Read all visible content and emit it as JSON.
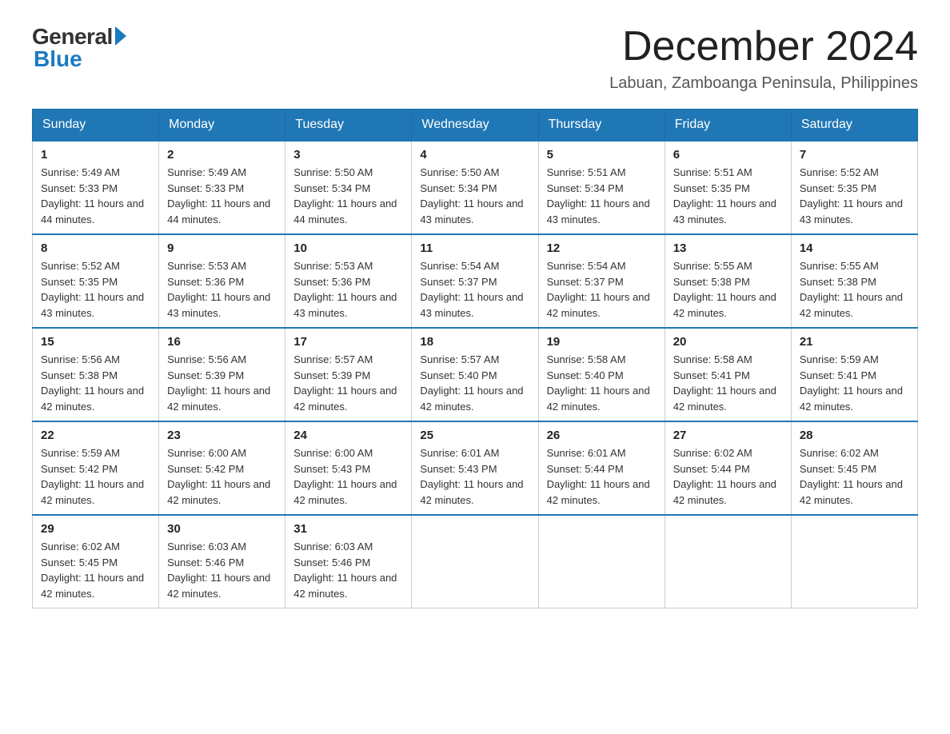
{
  "logo": {
    "general": "General",
    "blue": "Blue"
  },
  "header": {
    "month_title": "December 2024",
    "location": "Labuan, Zamboanga Peninsula, Philippines"
  },
  "weekdays": [
    "Sunday",
    "Monday",
    "Tuesday",
    "Wednesday",
    "Thursday",
    "Friday",
    "Saturday"
  ],
  "weeks": [
    [
      {
        "day": "1",
        "sunrise": "5:49 AM",
        "sunset": "5:33 PM",
        "daylight": "11 hours and 44 minutes."
      },
      {
        "day": "2",
        "sunrise": "5:49 AM",
        "sunset": "5:33 PM",
        "daylight": "11 hours and 44 minutes."
      },
      {
        "day": "3",
        "sunrise": "5:50 AM",
        "sunset": "5:34 PM",
        "daylight": "11 hours and 44 minutes."
      },
      {
        "day": "4",
        "sunrise": "5:50 AM",
        "sunset": "5:34 PM",
        "daylight": "11 hours and 43 minutes."
      },
      {
        "day": "5",
        "sunrise": "5:51 AM",
        "sunset": "5:34 PM",
        "daylight": "11 hours and 43 minutes."
      },
      {
        "day": "6",
        "sunrise": "5:51 AM",
        "sunset": "5:35 PM",
        "daylight": "11 hours and 43 minutes."
      },
      {
        "day": "7",
        "sunrise": "5:52 AM",
        "sunset": "5:35 PM",
        "daylight": "11 hours and 43 minutes."
      }
    ],
    [
      {
        "day": "8",
        "sunrise": "5:52 AM",
        "sunset": "5:35 PM",
        "daylight": "11 hours and 43 minutes."
      },
      {
        "day": "9",
        "sunrise": "5:53 AM",
        "sunset": "5:36 PM",
        "daylight": "11 hours and 43 minutes."
      },
      {
        "day": "10",
        "sunrise": "5:53 AM",
        "sunset": "5:36 PM",
        "daylight": "11 hours and 43 minutes."
      },
      {
        "day": "11",
        "sunrise": "5:54 AM",
        "sunset": "5:37 PM",
        "daylight": "11 hours and 43 minutes."
      },
      {
        "day": "12",
        "sunrise": "5:54 AM",
        "sunset": "5:37 PM",
        "daylight": "11 hours and 42 minutes."
      },
      {
        "day": "13",
        "sunrise": "5:55 AM",
        "sunset": "5:38 PM",
        "daylight": "11 hours and 42 minutes."
      },
      {
        "day": "14",
        "sunrise": "5:55 AM",
        "sunset": "5:38 PM",
        "daylight": "11 hours and 42 minutes."
      }
    ],
    [
      {
        "day": "15",
        "sunrise": "5:56 AM",
        "sunset": "5:38 PM",
        "daylight": "11 hours and 42 minutes."
      },
      {
        "day": "16",
        "sunrise": "5:56 AM",
        "sunset": "5:39 PM",
        "daylight": "11 hours and 42 minutes."
      },
      {
        "day": "17",
        "sunrise": "5:57 AM",
        "sunset": "5:39 PM",
        "daylight": "11 hours and 42 minutes."
      },
      {
        "day": "18",
        "sunrise": "5:57 AM",
        "sunset": "5:40 PM",
        "daylight": "11 hours and 42 minutes."
      },
      {
        "day": "19",
        "sunrise": "5:58 AM",
        "sunset": "5:40 PM",
        "daylight": "11 hours and 42 minutes."
      },
      {
        "day": "20",
        "sunrise": "5:58 AM",
        "sunset": "5:41 PM",
        "daylight": "11 hours and 42 minutes."
      },
      {
        "day": "21",
        "sunrise": "5:59 AM",
        "sunset": "5:41 PM",
        "daylight": "11 hours and 42 minutes."
      }
    ],
    [
      {
        "day": "22",
        "sunrise": "5:59 AM",
        "sunset": "5:42 PM",
        "daylight": "11 hours and 42 minutes."
      },
      {
        "day": "23",
        "sunrise": "6:00 AM",
        "sunset": "5:42 PM",
        "daylight": "11 hours and 42 minutes."
      },
      {
        "day": "24",
        "sunrise": "6:00 AM",
        "sunset": "5:43 PM",
        "daylight": "11 hours and 42 minutes."
      },
      {
        "day": "25",
        "sunrise": "6:01 AM",
        "sunset": "5:43 PM",
        "daylight": "11 hours and 42 minutes."
      },
      {
        "day": "26",
        "sunrise": "6:01 AM",
        "sunset": "5:44 PM",
        "daylight": "11 hours and 42 minutes."
      },
      {
        "day": "27",
        "sunrise": "6:02 AM",
        "sunset": "5:44 PM",
        "daylight": "11 hours and 42 minutes."
      },
      {
        "day": "28",
        "sunrise": "6:02 AM",
        "sunset": "5:45 PM",
        "daylight": "11 hours and 42 minutes."
      }
    ],
    [
      {
        "day": "29",
        "sunrise": "6:02 AM",
        "sunset": "5:45 PM",
        "daylight": "11 hours and 42 minutes."
      },
      {
        "day": "30",
        "sunrise": "6:03 AM",
        "sunset": "5:46 PM",
        "daylight": "11 hours and 42 minutes."
      },
      {
        "day": "31",
        "sunrise": "6:03 AM",
        "sunset": "5:46 PM",
        "daylight": "11 hours and 42 minutes."
      },
      null,
      null,
      null,
      null
    ]
  ]
}
